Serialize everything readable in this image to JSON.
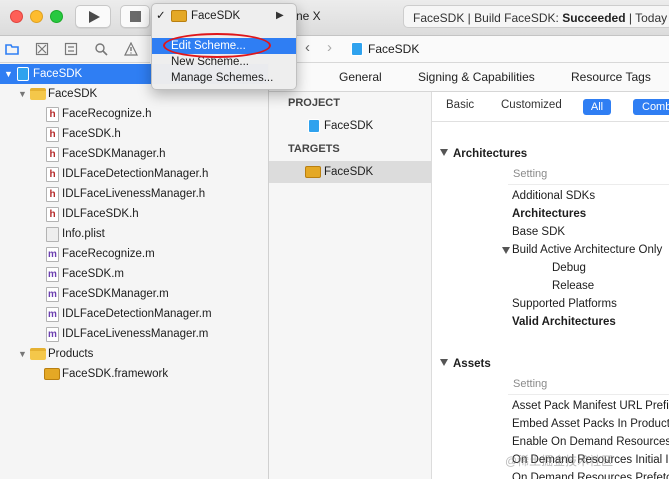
{
  "toolbar": {
    "scheme_tail": "ne X",
    "status_prefix": "FaceSDK | Build FaceSDK: ",
    "status_result": "Succeeded",
    "status_suffix": " | Today at"
  },
  "scheme_menu": {
    "current_check": "✓",
    "current_scheme": "FaceSDK",
    "items": [
      "Edit Scheme...",
      "New Scheme...",
      "Manage Schemes..."
    ]
  },
  "navigator": {
    "project": "FaceSDK",
    "folder": "FaceSDK",
    "files": [
      {
        "name": "FaceRecognize.h",
        "type": "h"
      },
      {
        "name": "FaceSDK.h",
        "type": "h"
      },
      {
        "name": "FaceSDKManager.h",
        "type": "h"
      },
      {
        "name": "IDLFaceDetectionManager.h",
        "type": "h"
      },
      {
        "name": "IDLFaceLivenessManager.h",
        "type": "h"
      },
      {
        "name": "IDLFaceSDK.h",
        "type": "h"
      },
      {
        "name": "Info.plist",
        "type": "plist"
      },
      {
        "name": "FaceRecognize.m",
        "type": "m"
      },
      {
        "name": "FaceSDK.m",
        "type": "m"
      },
      {
        "name": "FaceSDKManager.m",
        "type": "m"
      },
      {
        "name": "IDLFaceDetectionManager.m",
        "type": "m"
      },
      {
        "name": "IDLFaceLivenessManager.m",
        "type": "m"
      }
    ],
    "products_folder": "Products",
    "product": "FaceSDK.framework"
  },
  "jumpbar": {
    "title": "FaceSDK"
  },
  "editor_tabs": [
    "General",
    "Signing & Capabilities",
    "Resource Tags"
  ],
  "targets_pane": {
    "project_header": "PROJECT",
    "project_item": "FaceSDK",
    "targets_header": "TARGETS",
    "target_item": "FaceSDK"
  },
  "build_settings": {
    "filters": {
      "basic": "Basic",
      "customized": "Customized",
      "all": "All",
      "combined": "Comb"
    },
    "groups": [
      {
        "title": "Architectures",
        "column_header": "Setting",
        "rows": [
          "Additional SDKs",
          "Architectures",
          "Base SDK",
          "Build Active Architecture Only",
          "Debug",
          "Release",
          "Supported Platforms",
          "Valid Architectures"
        ]
      },
      {
        "title": "Assets",
        "column_header": "Setting",
        "rows": [
          "Asset Pack Manifest URL Prefix",
          "Embed Asset Packs In Product",
          "Enable On Demand Resources",
          "On Demand Resources Initial I",
          "On Demand Resources Prefetc"
        ]
      }
    ]
  },
  "watermark": "@稀土掘金技术社区",
  "colors": {
    "accent": "#2f7ef3",
    "annotation": "#e0161a"
  }
}
